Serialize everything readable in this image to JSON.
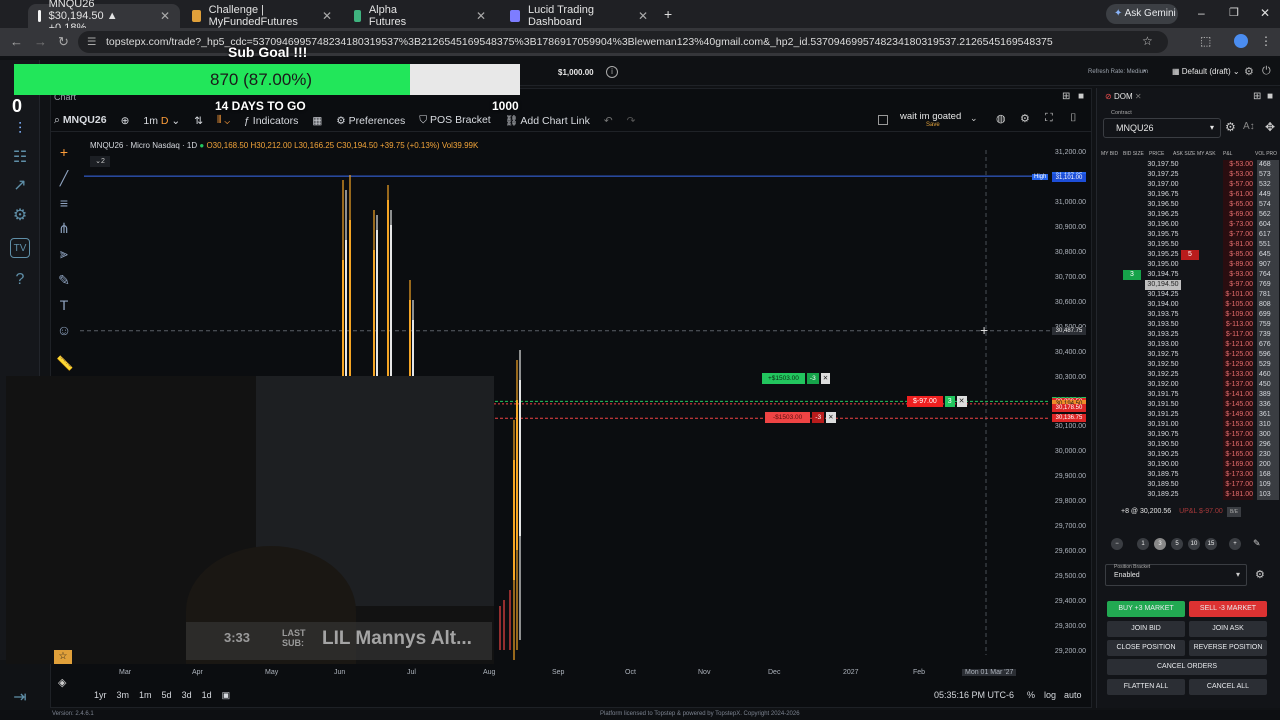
{
  "browser": {
    "tabs": [
      {
        "label": "MNQU26 $30,194.50 ▲ +0.18%",
        "active": true,
        "color": "#f5f5f5"
      },
      {
        "label": "Challenge | MyFundedFutures",
        "active": false,
        "color": "#e0a03a"
      },
      {
        "label": "Alpha Futures",
        "active": false,
        "color": "#3fb37f"
      },
      {
        "label": "Lucid Trading Dashboard",
        "active": false,
        "color": "#7d7dff"
      }
    ],
    "new_tab": "+",
    "ask_gemini": "Ask Gemini",
    "url": "topstepx.com/trade?_hp5_cdc=5370946995748234180319537%3B2126545169548375%3B1786917059904%3Bleweman123%40gmail.com&_hp2_id.5370946995748234180319537.2126545169548375"
  },
  "overlay": {
    "sub_goal_title": "Sub Goal !!!",
    "progress_text": "870 (87.00%)",
    "progress_fraction": 0.87,
    "days_to_go": "14 DAYS TO GO",
    "goal": "1000",
    "left_counter": "0",
    "balance": "$1,000.00",
    "webcam_timer": "3:33",
    "last_sub_label": "LAST SUB:",
    "last_sub_name": "LIL Mannys Alt..."
  },
  "chart_header": {
    "panel_label": "Chart",
    "symbol": "MNQU26",
    "timeframe": "1m",
    "interval": "D",
    "indicators": "Indicators",
    "preferences": "Preferences",
    "pos_bracket": "POS Bracket",
    "add_chart_link": "Add Chart Link",
    "layout_name": "wait im goated",
    "layout_sub": "Save",
    "legend_title": "MNQU26 · Micro Nasdaq · 1D",
    "open": "O30,168.50",
    "high": "H30,212.00",
    "low": "L30,166.25",
    "close": "C30,194.50",
    "change": "+39.75 (+0.13%)",
    "volume": "Vol39.99K",
    "badge": "2"
  },
  "chart_data": {
    "type": "candlestick",
    "y_axis": [
      "31,200.00",
      "31,100.00",
      "31,000.00",
      "30,900.00",
      "30,800.00",
      "30,700.00",
      "30,600.00",
      "30,500.00",
      "30,400.00",
      "30,300.00",
      "30,200.00",
      "30,100.00",
      "30,000.00",
      "29,900.00",
      "29,800.00",
      "29,700.00",
      "29,600.00",
      "29,500.00",
      "29,400.00",
      "29,300.00",
      "29,200.00"
    ],
    "x_axis": [
      "Mar",
      "Apr",
      "May",
      "Jun",
      "Jul",
      "Aug",
      "Sep",
      "Oct",
      "Nov",
      "Dec",
      "2027",
      "Feb",
      "Mon 01 Mar '27"
    ],
    "high_line": "31,107.25",
    "high_label": "High",
    "high_line2": "31,101.00",
    "crosshair_price": "30,487.75",
    "tp_order": {
      "label": "+$1503.00",
      "qty": "-3",
      "price": "30,204.50"
    },
    "sl_order": {
      "label": "-$1503.00",
      "qty": "-3",
      "price": "30,136.75"
    },
    "position": {
      "pnl": "$-97.00",
      "qty": "3",
      "price": "30,194.50"
    },
    "current_price": "30,194.50",
    "price_tags": [
      "30,200.50",
      "30,178.50"
    ]
  },
  "bottom_bar": {
    "ranges": [
      "1yr",
      "3m",
      "1m",
      "5d",
      "3d",
      "1d"
    ],
    "time": "05:35:16 PM UTC-6",
    "pct": "%",
    "log": "log",
    "auto": "auto"
  },
  "dom": {
    "title": "DOM",
    "contract_label": "Contract",
    "contract": "MNQU26",
    "columns": [
      "MY BID",
      "BID SIZE",
      "PRICE",
      "ASK SIZE",
      "MY ASK",
      "P&L",
      "VOL PRO"
    ],
    "rows": [
      {
        "price": "30,197.50",
        "pnl": "$-53.00",
        "vol": "468"
      },
      {
        "price": "30,197.25",
        "pnl": "$-53.00",
        "vol": "573"
      },
      {
        "price": "30,197.00",
        "pnl": "$-57.00",
        "vol": "532"
      },
      {
        "price": "30,196.75",
        "pnl": "$-61.00",
        "vol": "449"
      },
      {
        "price": "30,196.50",
        "pnl": "$-65.00",
        "vol": "574"
      },
      {
        "price": "30,196.25",
        "pnl": "$-69.00",
        "vol": "562"
      },
      {
        "price": "30,196.00",
        "pnl": "$-73.00",
        "vol": "604"
      },
      {
        "price": "30,195.75",
        "pnl": "$-77.00",
        "vol": "617"
      },
      {
        "price": "30,195.50",
        "pnl": "$-81.00",
        "vol": "551"
      },
      {
        "price": "30,195.25",
        "pnl": "$-85.00",
        "vol": "645",
        "ask": "5"
      },
      {
        "price": "30,195.00",
        "pnl": "$-89.00",
        "vol": "907"
      },
      {
        "price": "30,194.75",
        "pnl": "$-93.00",
        "vol": "764",
        "bid": "3"
      },
      {
        "price": "30,194.50",
        "pnl": "$-97.00",
        "vol": "769"
      },
      {
        "price": "30,194.25",
        "pnl": "$-101.00",
        "vol": "781"
      },
      {
        "price": "30,194.00",
        "pnl": "$-105.00",
        "vol": "808"
      },
      {
        "price": "30,193.75",
        "pnl": "$-109.00",
        "vol": "699"
      },
      {
        "price": "30,193.50",
        "pnl": "$-113.00",
        "vol": "759"
      },
      {
        "price": "30,193.25",
        "pnl": "$-117.00",
        "vol": "739"
      },
      {
        "price": "30,193.00",
        "pnl": "$-121.00",
        "vol": "676"
      },
      {
        "price": "30,192.75",
        "pnl": "$-125.00",
        "vol": "596"
      },
      {
        "price": "30,192.50",
        "pnl": "$-129.00",
        "vol": "529"
      },
      {
        "price": "30,192.25",
        "pnl": "$-133.00",
        "vol": "460"
      },
      {
        "price": "30,192.00",
        "pnl": "$-137.00",
        "vol": "450"
      },
      {
        "price": "30,191.75",
        "pnl": "$-141.00",
        "vol": "389"
      },
      {
        "price": "30,191.50",
        "pnl": "$-145.00",
        "vol": "336"
      },
      {
        "price": "30,191.25",
        "pnl": "$-149.00",
        "vol": "361"
      },
      {
        "price": "30,191.00",
        "pnl": "$-153.00",
        "vol": "310"
      },
      {
        "price": "30,190.75",
        "pnl": "$-157.00",
        "vol": "300"
      },
      {
        "price": "30,190.50",
        "pnl": "$-161.00",
        "vol": "296"
      },
      {
        "price": "30,190.25",
        "pnl": "$-165.00",
        "vol": "230"
      },
      {
        "price": "30,190.00",
        "pnl": "$-169.00",
        "vol": "200"
      },
      {
        "price": "30,189.75",
        "pnl": "$-173.00",
        "vol": "168"
      },
      {
        "price": "30,189.50",
        "pnl": "$-177.00",
        "vol": "109"
      },
      {
        "price": "30,189.25",
        "pnl": "$-181.00",
        "vol": "103"
      }
    ],
    "position_summary": "+8 @ 30,200.56",
    "upl": "UP&L $-97.00",
    "be": "B/E",
    "qty_options": [
      "1",
      "3",
      "5",
      "10",
      "15"
    ],
    "position_bracket_label": "Position Bracket",
    "position_bracket_value": "Enabled",
    "buy_market": "BUY +3 MARKET",
    "sell_market": "SELL -3 MARKET",
    "join_bid": "JOIN BID",
    "join_ask": "JOIN ASK",
    "close_position": "CLOSE POSITION",
    "reverse_position": "REVERSE POSITION",
    "cancel_orders": "CANCEL ORDERS",
    "flatten_all": "FLATTEN ALL",
    "cancel_all": "CANCEL ALL"
  },
  "status": {
    "version": "Version: 2.4.6.1",
    "copyright": "Platform licensed to Topstep & powered by TopstepX. Copyright 2024-2026",
    "refresh": "Refresh Rate: Medium",
    "layout": "Default (draft)"
  },
  "colors": {
    "green": "#22c55e",
    "red": "#ef4444",
    "accent": "#1d4ed8",
    "progress": "#22e65a"
  }
}
